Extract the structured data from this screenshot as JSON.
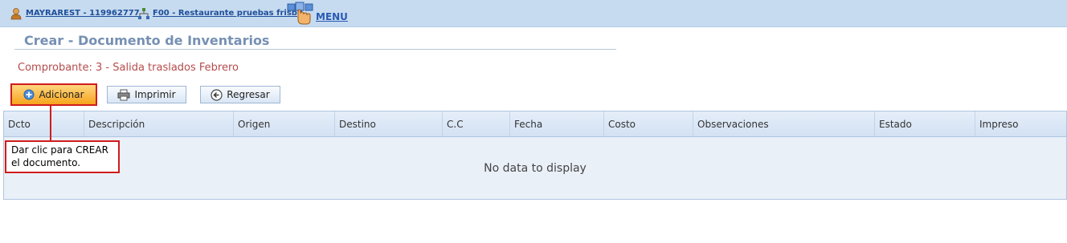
{
  "topbar": {
    "user": "MAYRAREST - 119962777",
    "company": "F00 - Restaurante pruebas frisby",
    "menu": "MENU"
  },
  "page": {
    "title": "Crear - Documento de Inventarios",
    "subtitle": "Comprobante: 3 - Salida traslados Febrero"
  },
  "toolbar": {
    "add_label": "Adicionar",
    "print_label": "Imprimir",
    "back_label": "Regresar"
  },
  "grid": {
    "columns": [
      "Dcto",
      "Descripción",
      "Origen",
      "Destino",
      "C.C",
      "Fecha",
      "Costo",
      "Observaciones",
      "Estado",
      "Impreso"
    ],
    "empty_text": "No data to display"
  },
  "callout": {
    "text": "Dar clic para CREAR el documento."
  },
  "colors": {
    "topbar_bg": "#c6dbef",
    "title": "#7690b3",
    "subtitle": "#b64b4b",
    "highlight": "#d01c1c",
    "add_button": "#f6a51c"
  }
}
